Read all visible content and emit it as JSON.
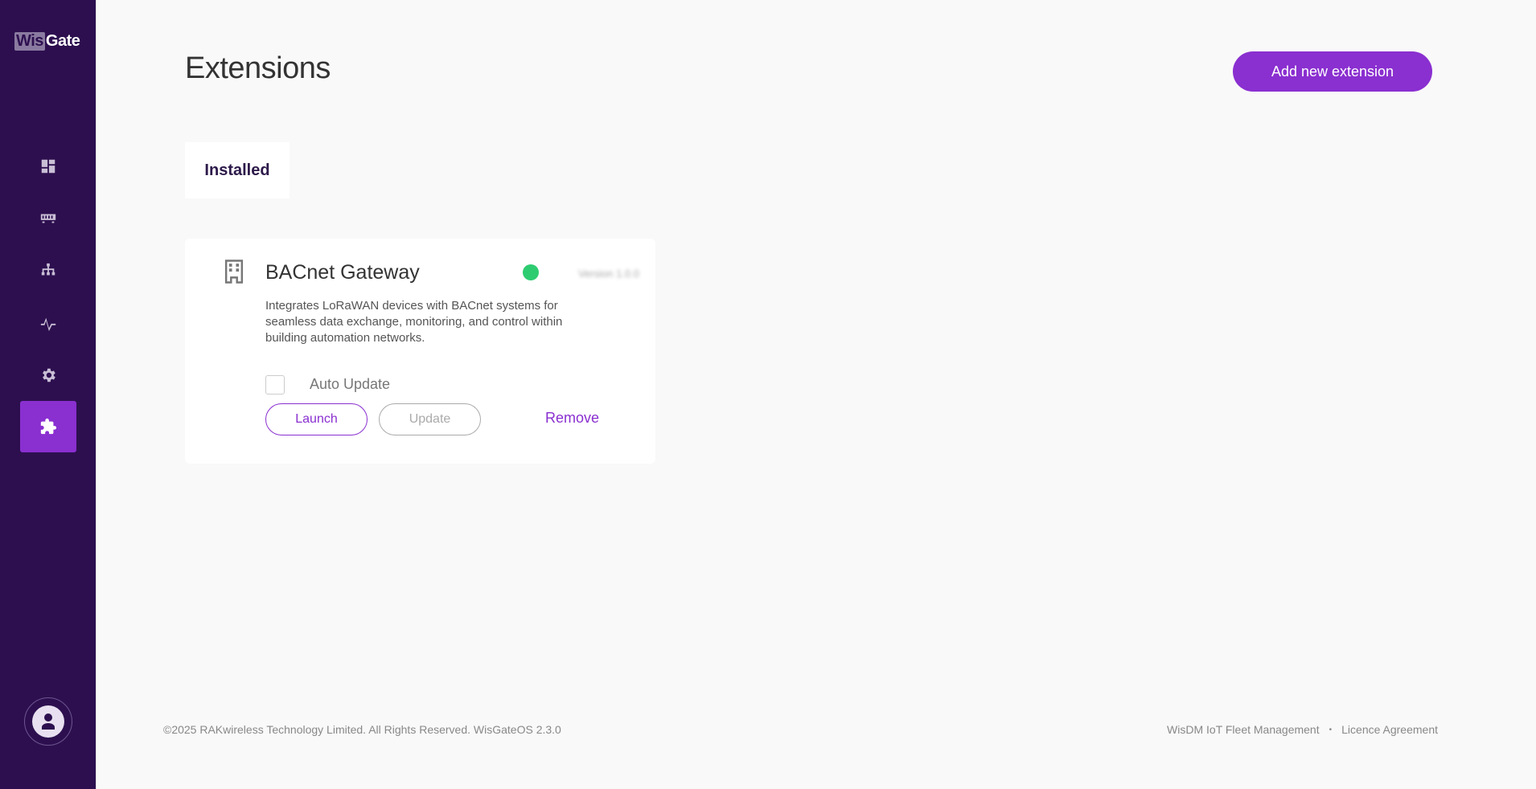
{
  "brand": {
    "logo_part1": "Wis",
    "logo_part2": "Gate"
  },
  "sidebar": {
    "items": [
      {
        "icon": "dashboard-icon",
        "active": false
      },
      {
        "icon": "gateway-icon",
        "active": false
      },
      {
        "icon": "network-icon",
        "active": false
      },
      {
        "icon": "activity-icon",
        "active": false
      },
      {
        "icon": "gear-icon",
        "active": false
      },
      {
        "icon": "puzzle-icon",
        "active": true
      }
    ],
    "profile_icon": "user-icon"
  },
  "page": {
    "title": "Extensions",
    "add_button": "Add new extension"
  },
  "tabs": {
    "installed": "Installed"
  },
  "extension": {
    "icon": "building-icon",
    "name": "BACnet Gateway",
    "status_color": "#2ecc71",
    "version": "Version 1.0.0",
    "description": "Integrates LoRaWAN devices with BACnet systems for seamless data exchange, monitoring, and control within building automation networks.",
    "auto_update_label": "Auto Update",
    "auto_update_checked": false,
    "launch_label": "Launch",
    "update_label": "Update",
    "remove_label": "Remove"
  },
  "footer": {
    "copyright": "©2025 RAKwireless Technology Limited. All Rights Reserved. WisGateOS 2.3.0",
    "link1": "WisDM IoT Fleet Management",
    "separator": "•",
    "link2": "Licence Agreement"
  },
  "colors": {
    "sidebar_bg": "#2d0f4f",
    "accent": "#8a2fd0",
    "status_active": "#2ecc71"
  }
}
